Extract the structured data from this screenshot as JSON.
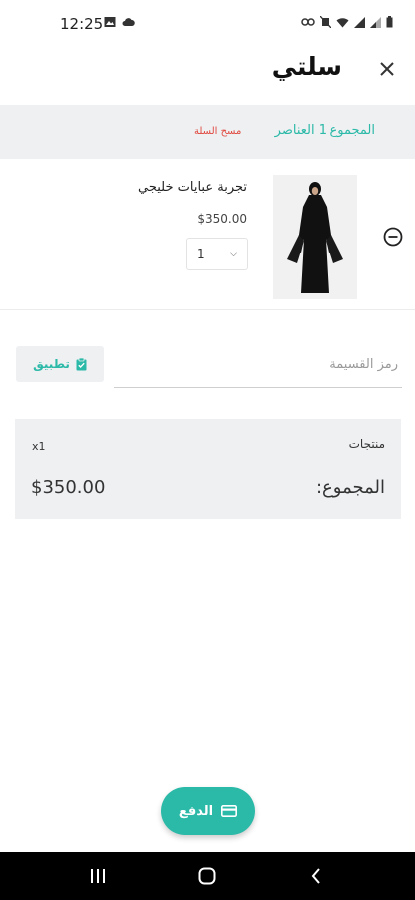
{
  "status_bar": {
    "time": "12:25",
    "left_icons": [
      "image-icon",
      "cloud-icon"
    ],
    "right_icons": [
      "link-icon",
      "mute-icon",
      "wifi-icon",
      "signal-icon",
      "signal-icon",
      "battery-icon"
    ]
  },
  "header": {
    "title": "سلتي",
    "close_icon": "close-icon"
  },
  "summary": {
    "total_label": "المجموع",
    "items_count": "1 العناصر",
    "clear_cart": "مسح السلة"
  },
  "cart": {
    "items": [
      {
        "name": "تجربة عبايات خليجي",
        "price": "$350.00",
        "quantity": "1"
      }
    ]
  },
  "coupon": {
    "placeholder": "رمز القسيمة",
    "apply_label": "تطبيق"
  },
  "totals": {
    "products_label": "منتجات",
    "products_count": "x1",
    "total_label": "المجموع:",
    "total_value": "$350.00"
  },
  "pay": {
    "label": "الدفع"
  },
  "colors": {
    "accent": "#2bb9a8",
    "danger": "#e0483e",
    "panel": "#eef0f2"
  }
}
